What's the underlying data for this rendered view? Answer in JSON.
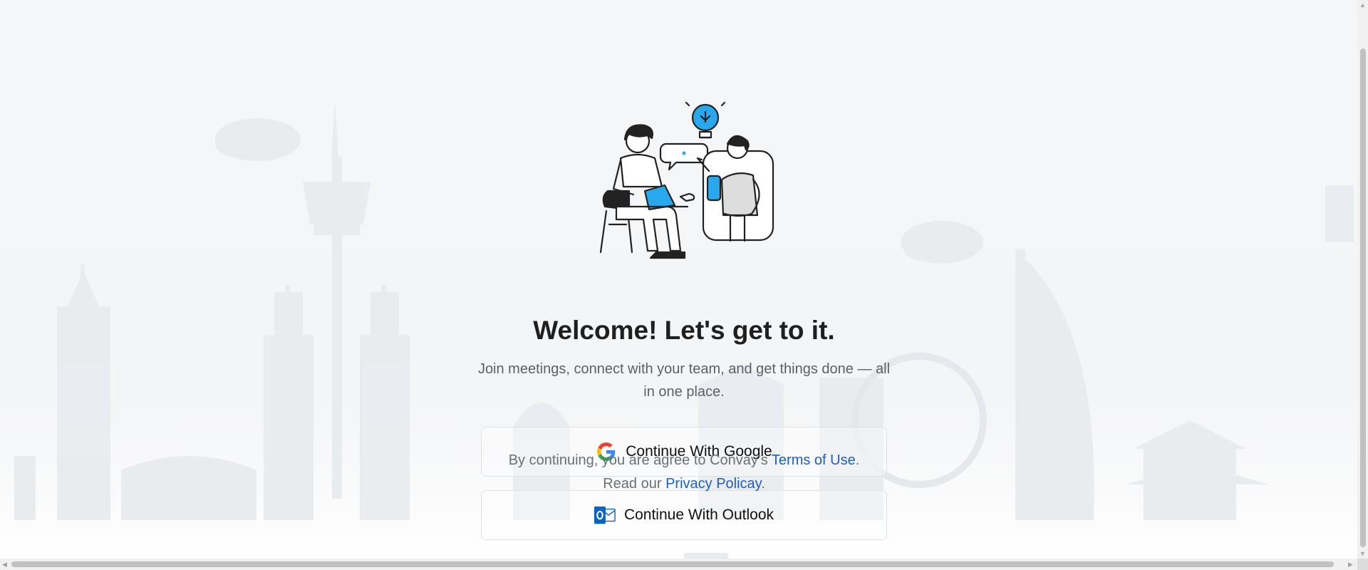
{
  "welcome": {
    "title": "Welcome! Let's get to it.",
    "subtitle": "Join meetings, connect with your team, and get things done — all in one place."
  },
  "auth": {
    "google_label": "Continue With Google",
    "outlook_label": "Continue With Outlook"
  },
  "legal": {
    "prefix": "By continuing, you are agree to Convay's ",
    "terms_link": "Terms of Use",
    "period1": ".",
    "read_prefix": "Read our ",
    "privacy_link": "Privacy Policay",
    "period2": "."
  },
  "icons": {
    "google": "google-logo-icon",
    "outlook": "outlook-logo-icon",
    "scroll_left": "◀",
    "scroll_right": "▶",
    "scroll_up": "▲",
    "scroll_down": "▼"
  },
  "colors": {
    "accent_blue": "#2aa8ee",
    "link": "#1d5fc1",
    "title": "#1f1f1f"
  }
}
